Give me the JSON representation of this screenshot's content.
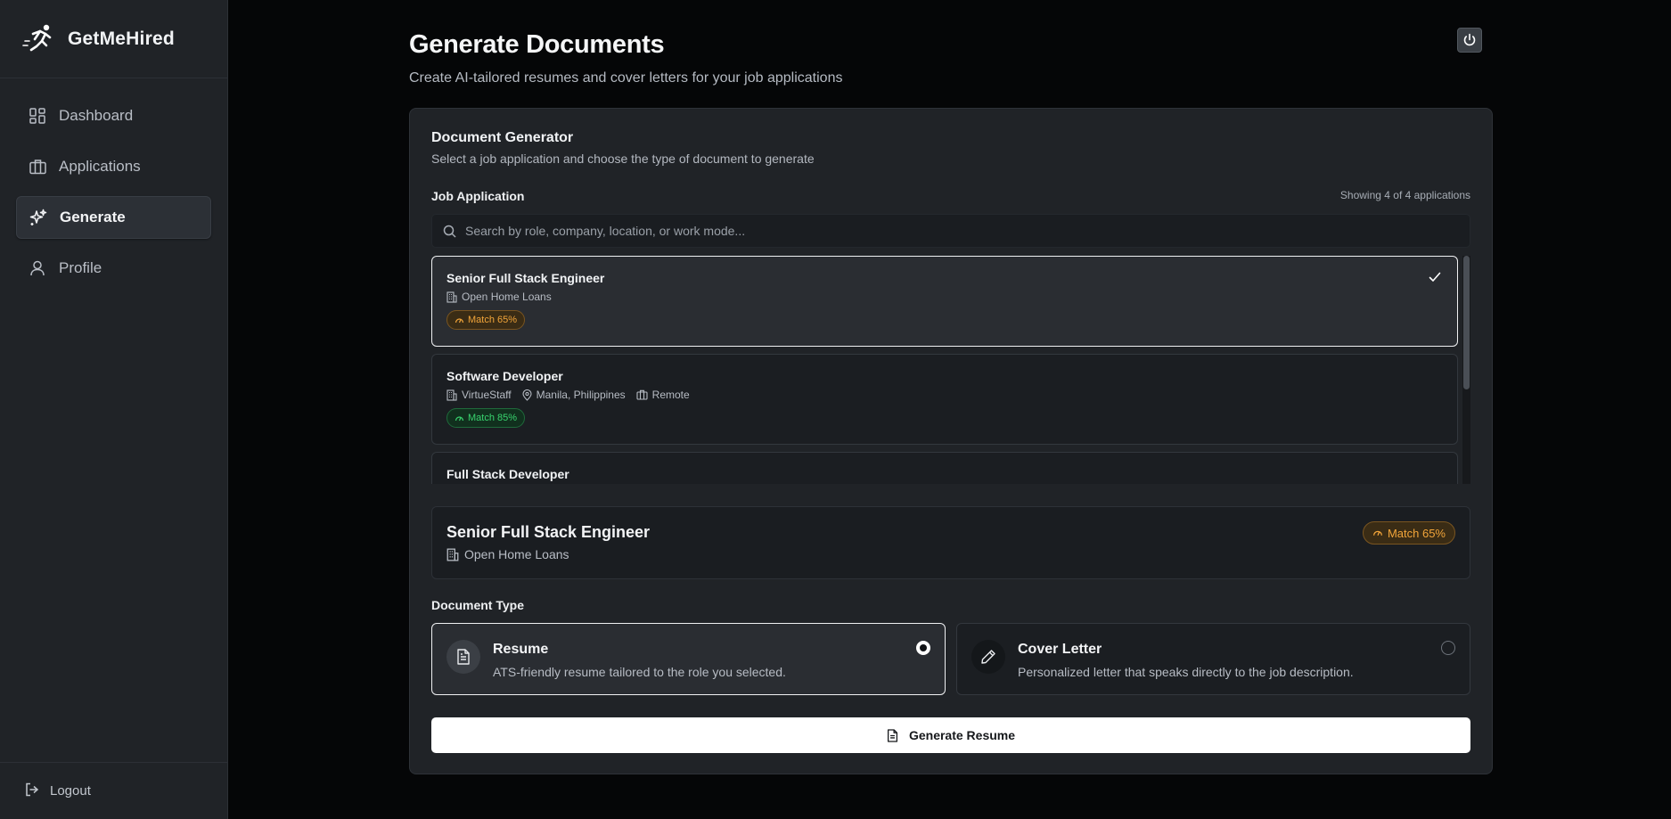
{
  "app": {
    "name": "GetMeHired"
  },
  "sidebar": {
    "items": [
      {
        "label": "Dashboard",
        "icon": "dashboard-icon",
        "active": false
      },
      {
        "label": "Applications",
        "icon": "briefcase-icon",
        "active": false
      },
      {
        "label": "Generate",
        "icon": "sparkles-icon",
        "active": true
      },
      {
        "label": "Profile",
        "icon": "user-icon",
        "active": false
      }
    ],
    "logout_label": "Logout"
  },
  "header": {
    "title": "Generate Documents",
    "subtitle": "Create AI-tailored resumes and cover letters for your job applications"
  },
  "generator": {
    "title": "Document Generator",
    "description": "Select a job application and choose the type of document to generate",
    "job_label": "Job Application",
    "showing_text": "Showing 4 of 4 applications",
    "search_placeholder": "Search by role, company, location, or work mode...",
    "jobs": [
      {
        "title": "Senior Full Stack Engineer",
        "company": "Open Home Loans",
        "location": "",
        "work_mode": "",
        "match": "Match 65%",
        "match_color": "#f2a53a",
        "selected": true
      },
      {
        "title": "Software Developer",
        "company": "VirtueStaff",
        "location": "Manila, Philippines",
        "work_mode": "Remote",
        "match": "Match 85%",
        "match_color": "#38d36e",
        "selected": false
      },
      {
        "title": "Full Stack Developer",
        "company": "",
        "location": "",
        "work_mode": "",
        "match": "",
        "selected": false
      }
    ],
    "selected_job": {
      "title": "Senior Full Stack Engineer",
      "company": "Open Home Loans",
      "match": "Match 65%"
    },
    "document_type_label": "Document Type",
    "document_types": [
      {
        "name": "Resume",
        "description": "ATS-friendly resume tailored to the role you selected.",
        "selected": true
      },
      {
        "name": "Cover Letter",
        "description": "Personalized letter that speaks directly to the job description.",
        "selected": false
      }
    ],
    "generate_label": "Generate Resume"
  },
  "colors": {
    "background": "#050607",
    "sidebar": "#202327",
    "card": "#202327",
    "match_orange": "#f2a53a",
    "match_green": "#38d36e"
  }
}
